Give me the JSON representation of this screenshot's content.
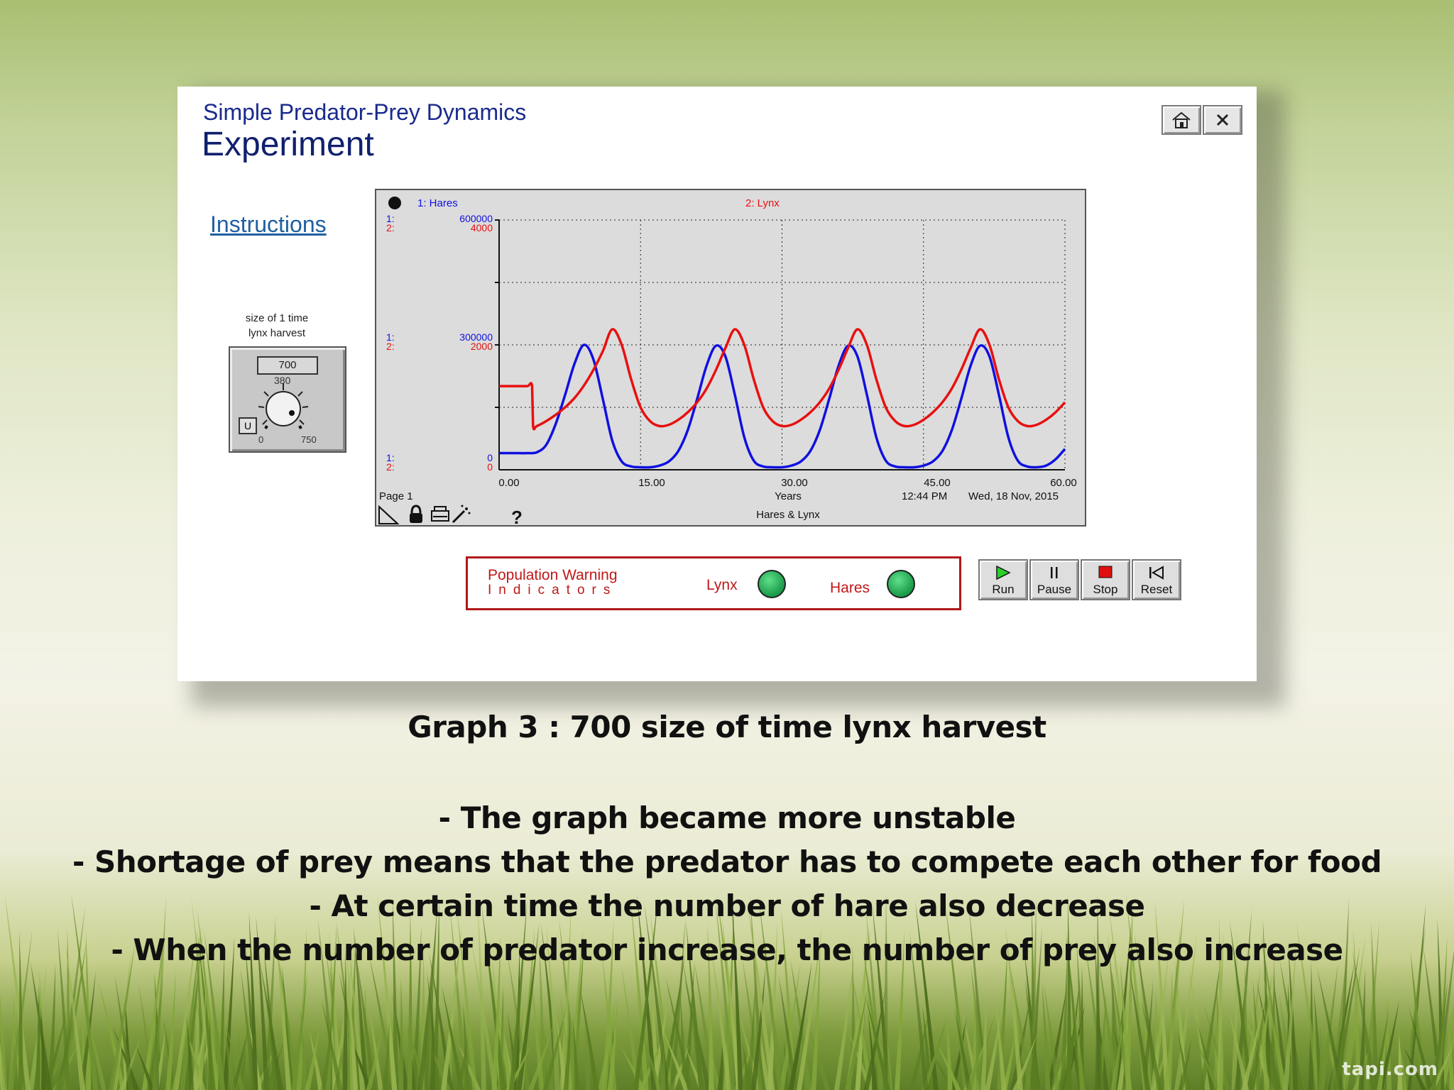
{
  "app": {
    "subtitle": "Simple Predator-Prey Dynamics",
    "title": "Experiment",
    "home_icon": "home-icon",
    "close_icon": "close-icon"
  },
  "instructions_link": "Instructions",
  "knob": {
    "label_line1": "size of 1 time",
    "label_line2": "lynx harvest",
    "value": "700",
    "mid_label": "380",
    "min_label": "0",
    "max_label": "750",
    "u_button": "U"
  },
  "graph": {
    "legend_1": "1: Hares",
    "legend_2": "2: Lynx",
    "axis_markers": {
      "top_1": "1:",
      "top_2": "2:",
      "mid_1": "1:",
      "mid_2": "2:",
      "bot_1": "1:",
      "bot_2": "2:"
    },
    "y1_ticks": [
      "600000",
      "300000",
      "0"
    ],
    "y2_ticks": [
      "4000",
      "2000",
      "0"
    ],
    "x_ticks": [
      "0.00",
      "15.00",
      "30.00",
      "45.00",
      "60.00"
    ],
    "x_label": "Years",
    "page_label": "Page 1",
    "time": "12:44 PM",
    "date": "Wed, 18 Nov, 2015",
    "graph_name": "Hares & Lynx",
    "help": "?"
  },
  "chart_data": {
    "type": "line",
    "xlim": [
      0,
      60
    ],
    "x_unit": "Years",
    "series": [
      {
        "name": "1: Hares",
        "axis": "y1",
        "ylim": [
          0,
          600000
        ],
        "color": "#1010e0",
        "x": [
          0,
          1,
          2,
          3,
          4,
          5,
          6,
          7,
          8,
          9,
          10,
          11,
          12,
          13,
          14,
          15,
          16,
          17,
          18,
          19,
          20,
          21,
          22,
          23,
          24,
          25,
          26,
          27,
          28,
          29,
          30,
          31,
          32,
          33,
          34,
          35,
          36,
          37,
          38,
          39,
          40,
          41,
          42,
          43,
          44,
          45,
          46,
          47,
          48,
          49,
          50,
          51,
          52,
          53,
          54,
          55,
          56,
          57,
          58,
          59,
          60
        ],
        "y": [
          40000,
          40000,
          40000,
          40000,
          42000,
          60000,
          110000,
          180000,
          255000,
          300000,
          265000,
          170000,
          70000,
          20000,
          8000,
          6000,
          6000,
          10000,
          20000,
          45000,
          95000,
          170000,
          250000,
          298000,
          272000,
          180000,
          78000,
          22000,
          8000,
          6000,
          6000,
          10000,
          20000,
          45000,
          95000,
          170000,
          250000,
          298000,
          272000,
          180000,
          78000,
          22000,
          8000,
          6000,
          6000,
          10000,
          20000,
          45000,
          95000,
          170000,
          250000,
          298000,
          272000,
          180000,
          78000,
          22000,
          8000,
          6000,
          10000,
          25000,
          50000
        ]
      },
      {
        "name": "2: Lynx",
        "axis": "y2",
        "ylim": [
          0,
          4000
        ],
        "color": "#e81010",
        "x": [
          0,
          1,
          2,
          3,
          3.5,
          3.6,
          4,
          5,
          6,
          7,
          8,
          9,
          10,
          11,
          12,
          13,
          14,
          15,
          16,
          17,
          18,
          19,
          20,
          21,
          22,
          23,
          24,
          25,
          26,
          27,
          28,
          29,
          30,
          31,
          32,
          33,
          34,
          35,
          36,
          37,
          38,
          39,
          40,
          41,
          42,
          43,
          44,
          45,
          46,
          47,
          48,
          49,
          50,
          51,
          52,
          53,
          54,
          55,
          56,
          57,
          58,
          59,
          60
        ],
        "y": [
          1340,
          1340,
          1340,
          1340,
          1340,
          700,
          700,
          780,
          880,
          1000,
          1150,
          1350,
          1600,
          1900,
          2250,
          2000,
          1450,
          1000,
          780,
          700,
          720,
          800,
          920,
          1080,
          1300,
          1600,
          1950,
          2250,
          2000,
          1450,
          1000,
          780,
          700,
          720,
          800,
          920,
          1080,
          1300,
          1600,
          1950,
          2250,
          2000,
          1450,
          1000,
          780,
          700,
          720,
          800,
          920,
          1080,
          1300,
          1600,
          1950,
          2250,
          2000,
          1450,
          1000,
          780,
          700,
          720,
          800,
          920,
          1080
        ]
      }
    ]
  },
  "indicators": {
    "title_line1": "Population Warning",
    "title_line2": "Indicators",
    "lynx": "Lynx",
    "hares": "Hares",
    "lynx_status_color": "#1a9a48",
    "hares_status_color": "#1a9a48"
  },
  "controls": {
    "run": "Run",
    "pause": "Pause",
    "stop": "Stop",
    "reset": "Reset"
  },
  "slide": {
    "caption": "Graph 3 : 700 size of  time lynx harvest",
    "bullets": [
      "- The graph became more unstable",
      "- Shortage of prey means that the predator has to compete each other for food",
      "- At certain time the number of hare also decrease",
      "- When the number of predator increase, the number of prey also increase"
    ],
    "watermark": "tapi.com"
  }
}
